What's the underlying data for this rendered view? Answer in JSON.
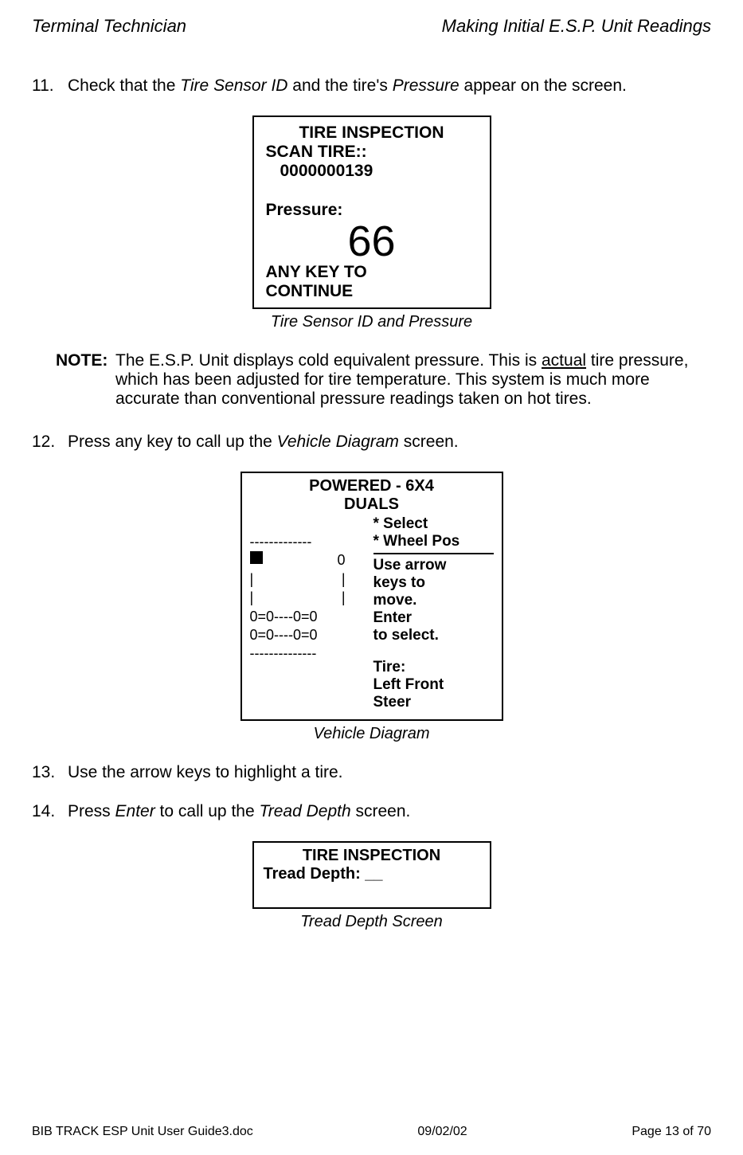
{
  "header": {
    "left": "Terminal Technician",
    "right": "Making Initial E.S.P. Unit Readings"
  },
  "step11": {
    "num": "11.",
    "text_before": "Check that the ",
    "italic1": "Tire Sensor ID",
    "text_mid": " and the tire's ",
    "italic2": "Pressure",
    "text_after": " appear on the screen."
  },
  "screen1": {
    "title": "TIRE INSPECTION",
    "scan": "SCAN TIRE::",
    "id": "0000000139",
    "pressure_label": "Pressure:",
    "pressure_value": "66",
    "anykey1": "ANY KEY TO",
    "anykey2": "CONTINUE"
  },
  "caption1": "Tire Sensor ID and Pressure",
  "note": {
    "label": "NOTE:",
    "text1": "The E.S.P. Unit displays cold equivalent pressure.  This is ",
    "underlined": "actual",
    "text2": " tire pressure, which has been adjusted for tire temperature.  This system is much more accurate than conventional pressure readings taken on hot tires."
  },
  "step12": {
    "num": "12.",
    "text_before": "Press any key to call up the ",
    "italic": "Vehicle Diagram",
    "text_after": " screen."
  },
  "screen2": {
    "title1": "POWERED - 6X4",
    "title2": "DUALS",
    "select": "* Select",
    "wheelpos": "* Wheel Pos",
    "instr1": "Use arrow",
    "instr2": "keys to",
    "instr3": "move.",
    "instr4": "Enter",
    "instr5": "to select.",
    "tirelabel": "Tire:",
    "tire1": "Left Front",
    "tire2": "Steer",
    "diag_dashes": "-------------",
    "diag_zero": "0",
    "diag_pipe": "|",
    "diag_axle": "0=0----0=0",
    "diag_dashes2": "--------------"
  },
  "caption2": "Vehicle Diagram",
  "step13": {
    "num": "13.",
    "text": "Use the arrow keys to highlight a tire."
  },
  "step14": {
    "num": "14.",
    "text_before": "Press ",
    "italic1": "Enter",
    "text_mid": " to call up the ",
    "italic2": "Tread Depth",
    "text_after": " screen."
  },
  "screen3": {
    "title": "TIRE INSPECTION",
    "tread": "Tread Depth: __"
  },
  "caption3": "Tread Depth Screen",
  "footer": {
    "left": "BIB TRACK  ESP Unit User Guide3.doc",
    "center": "09/02/02",
    "right": "Page 13 of 70"
  }
}
